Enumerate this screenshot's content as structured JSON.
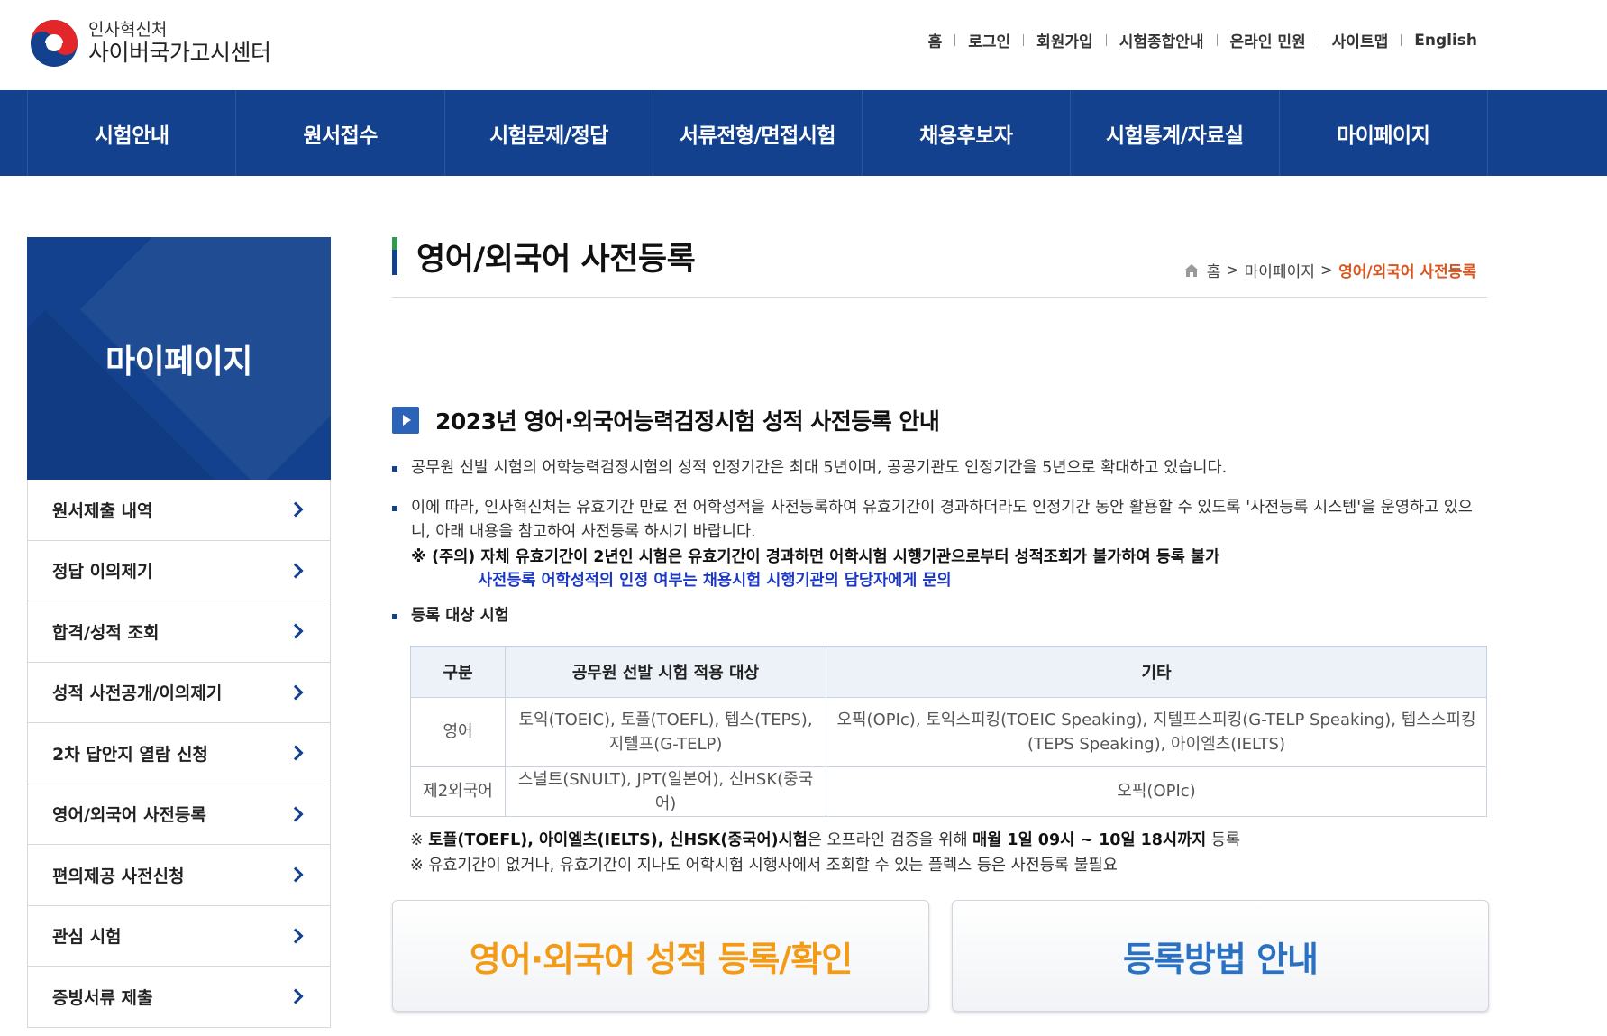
{
  "header": {
    "logo_top": "인사혁신처",
    "logo_main": "사이버국가고시센터",
    "util_links": [
      "홈",
      "로그인",
      "회원가입",
      "시험종합안내",
      "온라인 민원",
      "사이트맵",
      "English"
    ]
  },
  "gnb": [
    "시험안내",
    "원서접수",
    "시험문제/정답",
    "서류전형/면접시험",
    "채용후보자",
    "시험통계/자료실",
    "마이페이지"
  ],
  "sidebar": {
    "title": "마이페이지",
    "items": [
      "원서제출 내역",
      "정답 이의제기",
      "합격/성적 조회",
      "성적 사전공개/이의제기",
      "2차 답안지 열람 신청",
      "영어/외국어 사전등록",
      "편의제공 사전신청",
      "관심 시험",
      "증빙서류 제출"
    ]
  },
  "content": {
    "page_title": "영어/외국어 사전등록",
    "breadcrumb": {
      "home": "홈",
      "sep": ">",
      "parent": "마이페이지",
      "current": "영어/외국어 사전등록"
    },
    "section_title": "2023년 영어·외국어능력검정시험 성적 사전등록 안내",
    "bullet1": "공무원 선발 시험의 어학능력검정시험의 성적 인정기간은 최대 5년이며, 공공기관도 인정기간을 5년으로 확대하고 있습니다.",
    "bullet2": "이에 따라, 인사혁신처는 유효기간 만료 전 어학성적을 사전등록하여 유효기간이 경과하더라도 인정기간 동안 활용할 수 있도록 '사전등록 시스템'을 운영하고 있으니, 아래 내용을 참고하여 사전등록 하시기 바랍니다.",
    "note_red": "※ (주의) 자체 유효기간이 2년인 시험은 유효기간이 경과하면 어학시험 시행기관으로부터 성적조회가 불가하여 등록 불가",
    "note_blue": "사전등록 어학성적의 인정 여부는 채용시험 시행기관의 담당자에게 문의",
    "bullet3": "등록 대상 시험",
    "table": {
      "headers": [
        "구분",
        "공무원 선발 시험 적용 대상",
        "기타"
      ],
      "rows": [
        {
          "type": "영어",
          "target": "토익(TOEIC), 토플(TOEFL), 텝스(TEPS), 지텔프(G-TELP)",
          "etc": "오픽(OPIc), 토익스피킹(TOEIC Speaking), 지텔프스피킹(G-TELP Speaking), 텝스스피킹(TEPS Speaking), 아이엘츠(IELTS)"
        },
        {
          "type": "제2외국어",
          "target": "스널트(SNULT), JPT(일본어), 신HSK(중국어)",
          "etc": "오픽(OPIc)"
        }
      ]
    },
    "foot1_b1": "토플(TOEFL), 아이엘츠(IELTS), 신HSK(중국어)시험",
    "foot1_t1": "은 오프라인 검증을 위해 ",
    "foot1_b2": "매월 1일 09시 ~ 10일 18시까지",
    "foot1_t2": " 등록",
    "foot1_prefix": "※ ",
    "foot2": "※ 유효기간이 없거나, 유효기간이 지나도 어학시험 시행사에서 조회할 수 있는 플렉스 등은 사전등록 불필요",
    "button1": "영어·외국어 성적 등록/확인",
    "button2": "등록방법 안내"
  },
  "colors": {
    "nav": "#13418e",
    "accent_orange": "#f39a16",
    "accent_blue": "#2a71c4",
    "breadcrumb_current": "#d9541e",
    "note_blue": "#1c37c4"
  }
}
